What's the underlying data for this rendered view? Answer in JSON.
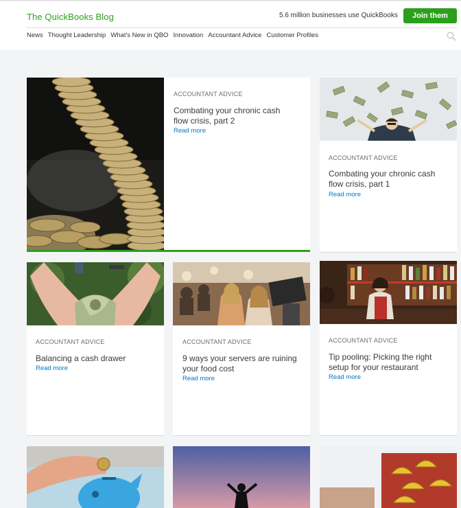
{
  "header": {
    "brand": "The QuickBooks Blog",
    "tagline": "5.6 million businesses use QuickBooks",
    "join_label": "Join them",
    "nav": [
      "News",
      "Thought Leadership",
      "What's New in QBO",
      "Innovation",
      "Accountant Advice",
      "Customer Profiles"
    ],
    "search_icon": "search-icon"
  },
  "cards": [
    {
      "category": "ACCOUNTANT ADVICE",
      "title": "Combating your chronic cash flow crisis, part 2",
      "link": "Read more"
    },
    {
      "category": "ACCOUNTANT ADVICE",
      "title": "Combating your chronic cash flow crisis, part 1",
      "link": "Read more"
    },
    {
      "category": "ACCOUNTANT ADVICE",
      "title": "Balancing a cash drawer",
      "link": "Read more"
    },
    {
      "category": "ACCOUNTANT ADVICE",
      "title": "9 ways your servers are ruining your food cost",
      "link": "Read more"
    },
    {
      "category": "ACCOUNTANT ADVICE",
      "title": "Tip pooling: Picking the right setup for your restaurant",
      "link": "Read more"
    }
  ],
  "colors": {
    "brand_green": "#2ca01c",
    "link_blue": "#0077c5"
  }
}
